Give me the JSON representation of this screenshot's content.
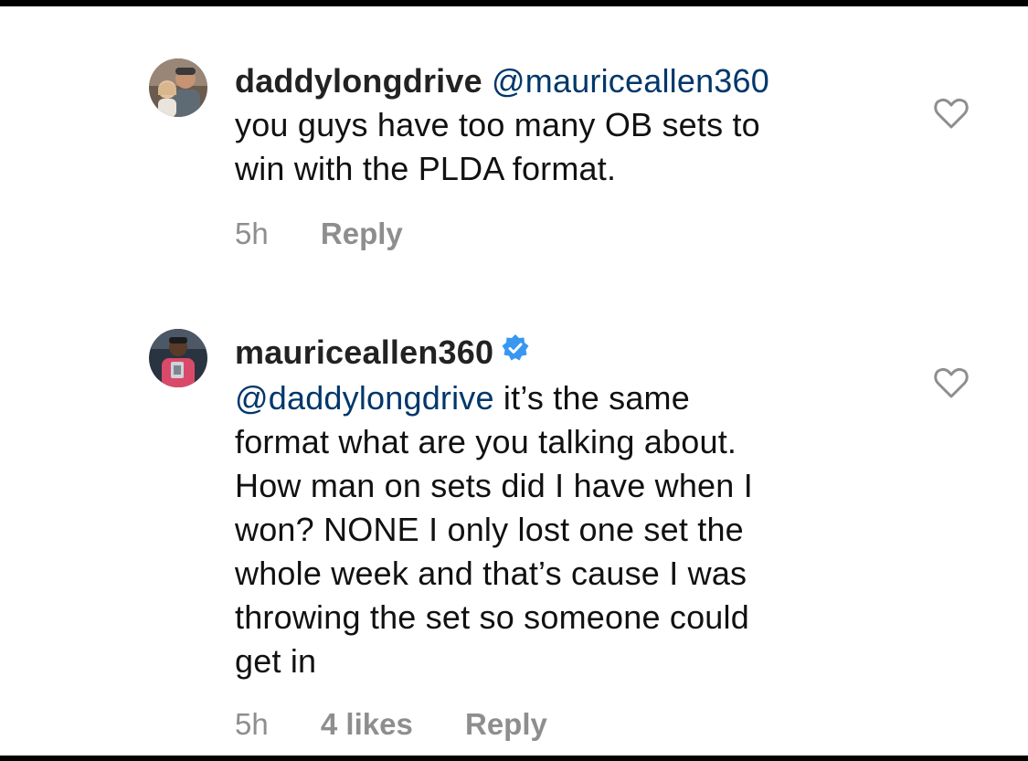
{
  "comments": [
    {
      "username": "daddylongdrive",
      "verified": false,
      "mention": "@mauriceallen360",
      "text_line1": "you guys have too many OB sets to",
      "text_line2": "win with the PLDA format.",
      "time": "5h",
      "likes": "",
      "reply_label": "Reply",
      "avatar_icon": "avatar-photo-father-daughter",
      "heart_icon": "heart-outline-icon"
    },
    {
      "username": "mauriceallen360",
      "verified": true,
      "verified_color": "#3897f0",
      "mention": "@daddylongdrive",
      "text_line1": " it’s the same",
      "lines": [
        "format what are you talking about.",
        "How man on sets did I have when I",
        "won? NONE I only lost one set the",
        "whole week and that’s cause I was",
        "throwing the set so someone could",
        "get in"
      ],
      "time": "5h",
      "likes": "4 likes",
      "reply_label": "Reply",
      "avatar_icon": "avatar-photo-trophy",
      "heart_icon": "heart-outline-icon"
    }
  ],
  "colors": {
    "text": "#111111",
    "mention": "#00376b",
    "meta": "#8e8e8e",
    "verified": "#3897f0"
  }
}
